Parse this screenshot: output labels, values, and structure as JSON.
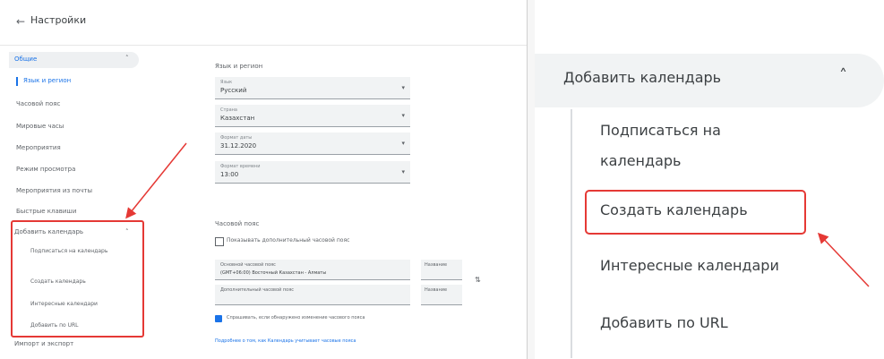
{
  "left": {
    "title": "Настройки",
    "sidebar": {
      "header": "Общие",
      "items": [
        "Язык и регион",
        "Часовой пояс",
        "Мировые часы",
        "Мероприятия",
        "Режим просмотра",
        "Мероприятия из почты",
        "Быстрые клавиши"
      ],
      "add_calendar": "Добавить календарь",
      "add_calendar_items": [
        "Подписаться на календарь",
        "Создать календарь",
        "Интересные календари",
        "Добавить по URL"
      ],
      "import_export": "Импорт и экспорт"
    },
    "main": {
      "language_section": "Язык и регион",
      "fields": [
        {
          "label": "Язык",
          "value": "Русский"
        },
        {
          "label": "Страна",
          "value": "Казахстан"
        },
        {
          "label": "Формат даты",
          "value": "31.12.2020"
        },
        {
          "label": "Формат времени",
          "value": "13:00"
        }
      ],
      "timezone_section": "Часовой пояс",
      "timezone_checkbox": "Показывать дополнительный часовой пояс",
      "primary_tz_label": "Основной часовой пояс",
      "primary_tz_value": "(GMT+06:00) Восточный Казахстан - Алматы",
      "secondary_tz_label": "Дополнительный часовой пояс",
      "name_label": "Название",
      "update_checkbox": "Спрашивать, если обнаружено изменение часового пояса",
      "link_text": "Подробнее о том, как Календарь учитывает часовые пояса"
    }
  },
  "right": {
    "header": "Добавить календарь",
    "items": [
      "Подписаться на",
      "календарь",
      "Создать календарь",
      "Интересные календари",
      "Добавить по URL"
    ]
  },
  "colors": {
    "highlight": "#e53935",
    "accent": "#1a73e8"
  }
}
